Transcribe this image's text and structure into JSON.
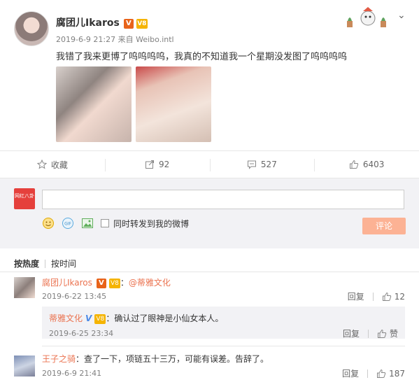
{
  "post": {
    "author": "腐团儿Ikaros",
    "v_badge": "V",
    "vip_badge": "V8",
    "meta": "2019-6-9 21:27 来自 Weibo.intl",
    "text": "我错了我来更博了呜呜呜呜，我真的不知道我一个星期没发图了呜呜呜呜"
  },
  "actions": {
    "favorite": "收藏",
    "repost": "92",
    "comment": "527",
    "like": "6403"
  },
  "compose": {
    "avatar_text": "网红八卦",
    "forward_label": "同时转发到我的微博",
    "submit": "评论"
  },
  "sort": {
    "hot": "按热度",
    "time": "按时间"
  },
  "comments": [
    {
      "author": "腐团儿Ikaros",
      "sep": "：",
      "text": "@蒂雅文化",
      "time": "2019-6-22 13:45",
      "reply": "回复",
      "likes": "12",
      "sub_reply": {
        "author": "蒂雅文化",
        "text": "：确认过了眼神是小仙女本人。",
        "time": "2019-6-25 23:34",
        "reply": "回复",
        "like": "赞"
      }
    },
    {
      "author": "王子之骑",
      "text": "：查了一下，项链五十三万，可能有误差。告辞了。",
      "time": "2019-6-9 21:41",
      "reply": "回复",
      "likes": "187"
    }
  ],
  "colors": {
    "link": "#eb7350",
    "accent": "#fcb294",
    "compose_bg": "#f2f2f5"
  }
}
